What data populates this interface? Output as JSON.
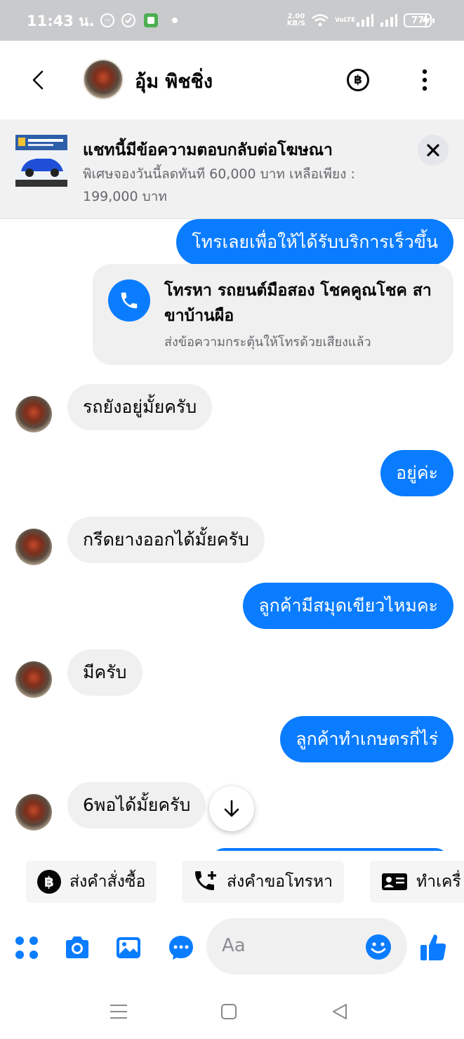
{
  "status_bar": {
    "time": "11:43 น.",
    "net_speed_value": "2.00",
    "net_speed_unit": "KB/S",
    "volte": "VoLTE",
    "battery": "77"
  },
  "header": {
    "contact_name": "อุ้ม พิชชิ่ง",
    "baht_symbol": "฿"
  },
  "ad_banner": {
    "title": "แชทนี้มีข้อความตอบกลับต่อโฆษณา",
    "description": "พิเศษจองวันนี้ลดทันที 60,000 บาท เหลือเพียง : 199,000 บาท"
  },
  "messages": [
    {
      "side": "out",
      "text": "โทรเลยเพื่อให้ได้รับบริการเร็วขึ้น"
    },
    {
      "side": "in",
      "text": "รถยังอยู่มั้ยครับ"
    },
    {
      "side": "out",
      "text": "อยู่ค่ะ"
    },
    {
      "side": "in",
      "text": "กรีดยางออกได้มั้ยครับ"
    },
    {
      "side": "out",
      "text": "ลูกค้ามีสมุดเขียวไหมคะ"
    },
    {
      "side": "in",
      "text": "มีครับ"
    },
    {
      "side": "out",
      "text": "ลูกค้าทำเกษตรกี่ไร่"
    },
    {
      "side": "in",
      "text": "6พอได้มั้ยครับ"
    }
  ],
  "call_card": {
    "title": "โทรหา รถยนต์มือสอง โชคคูณโชค สาขาบ้านผือ",
    "subtitle": "ส่งข้อความกระตุ้นให้โทรด้วยเสียงแล้ว"
  },
  "quick_replies": [
    {
      "label": "ส่งคำสั่งซื้อ",
      "icon": "baht-icon"
    },
    {
      "label": "ส่งคำขอโทรหา",
      "icon": "phone-add-icon"
    },
    {
      "label": "ทำเครื่",
      "icon": "contact-card-icon"
    }
  ],
  "composer": {
    "placeholder": "Aa"
  },
  "icons": [
    "back-arrow-icon",
    "more-vertical-icon",
    "close-icon",
    "phone-icon",
    "arrow-down-icon",
    "apps-grid-icon",
    "camera-icon",
    "gallery-icon",
    "chat-bubble-icon",
    "emoji-icon",
    "like-icon"
  ],
  "colors": {
    "accent": "#0A7CFF",
    "incoming_bubble": "#F0F0F0",
    "status_bar": "#C9CACC"
  }
}
